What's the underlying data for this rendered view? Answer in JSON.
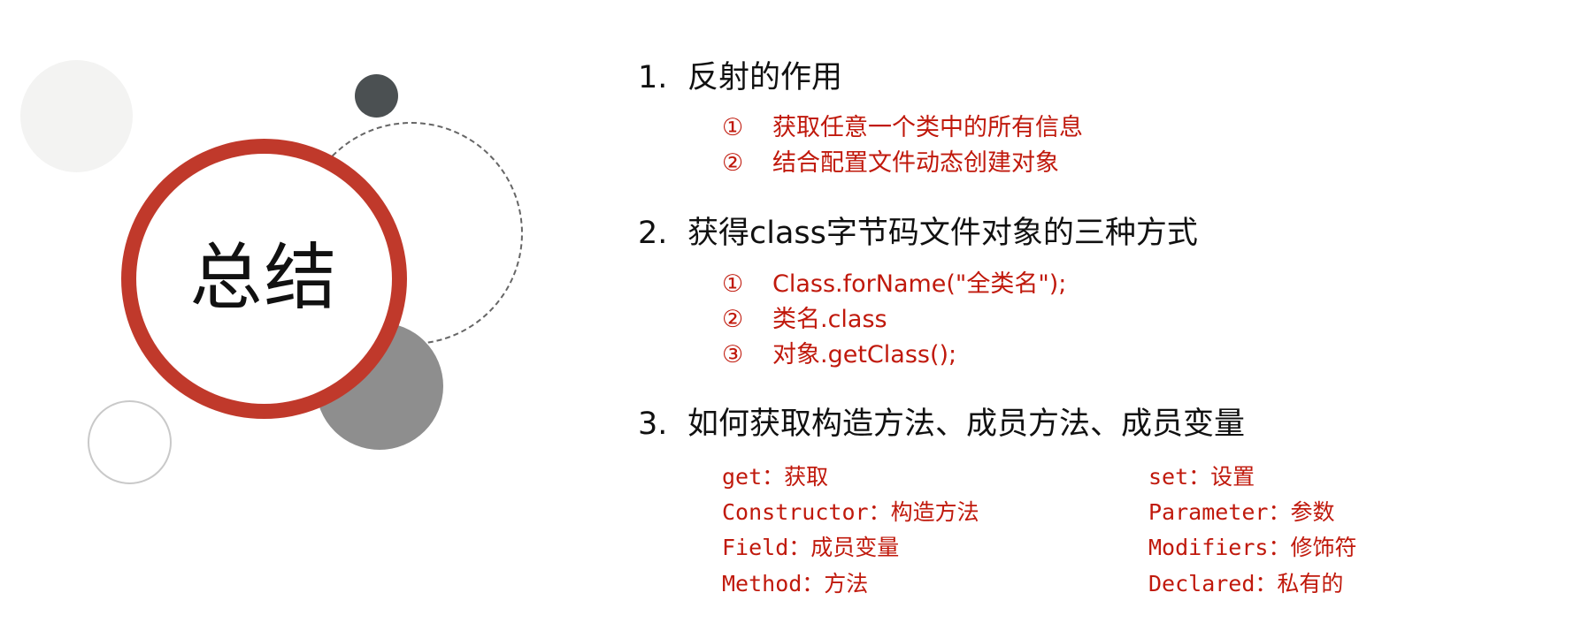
{
  "title": "总结",
  "sections": [
    {
      "number": "1.",
      "heading": "反射的作用",
      "items": [
        {
          "marker": "①",
          "text": "获取任意一个类中的所有信息"
        },
        {
          "marker": "②",
          "text": "结合配置文件动态创建对象"
        }
      ]
    },
    {
      "number": "2.",
      "heading": "获得class字节码文件对象的三种方式",
      "items": [
        {
          "marker": "①",
          "text": "Class.forName(\"全类名\");"
        },
        {
          "marker": "②",
          "text": "类名.class"
        },
        {
          "marker": "③",
          "text": "对象.getClass();"
        }
      ]
    },
    {
      "number": "3.",
      "heading": "如何获取构造方法、成员方法、成员变量",
      "terms_left": [
        "get：获取",
        "Constructor：构造方法",
        "Field：成员变量",
        "Method：方法"
      ],
      "terms_right": [
        "set：设置",
        "Parameter：参数",
        "Modifiers：修饰符",
        "Declared：私有的"
      ]
    }
  ],
  "colors": {
    "accent_red": "#c0392b",
    "text_red": "#c0190c",
    "text_dark": "#111111"
  }
}
